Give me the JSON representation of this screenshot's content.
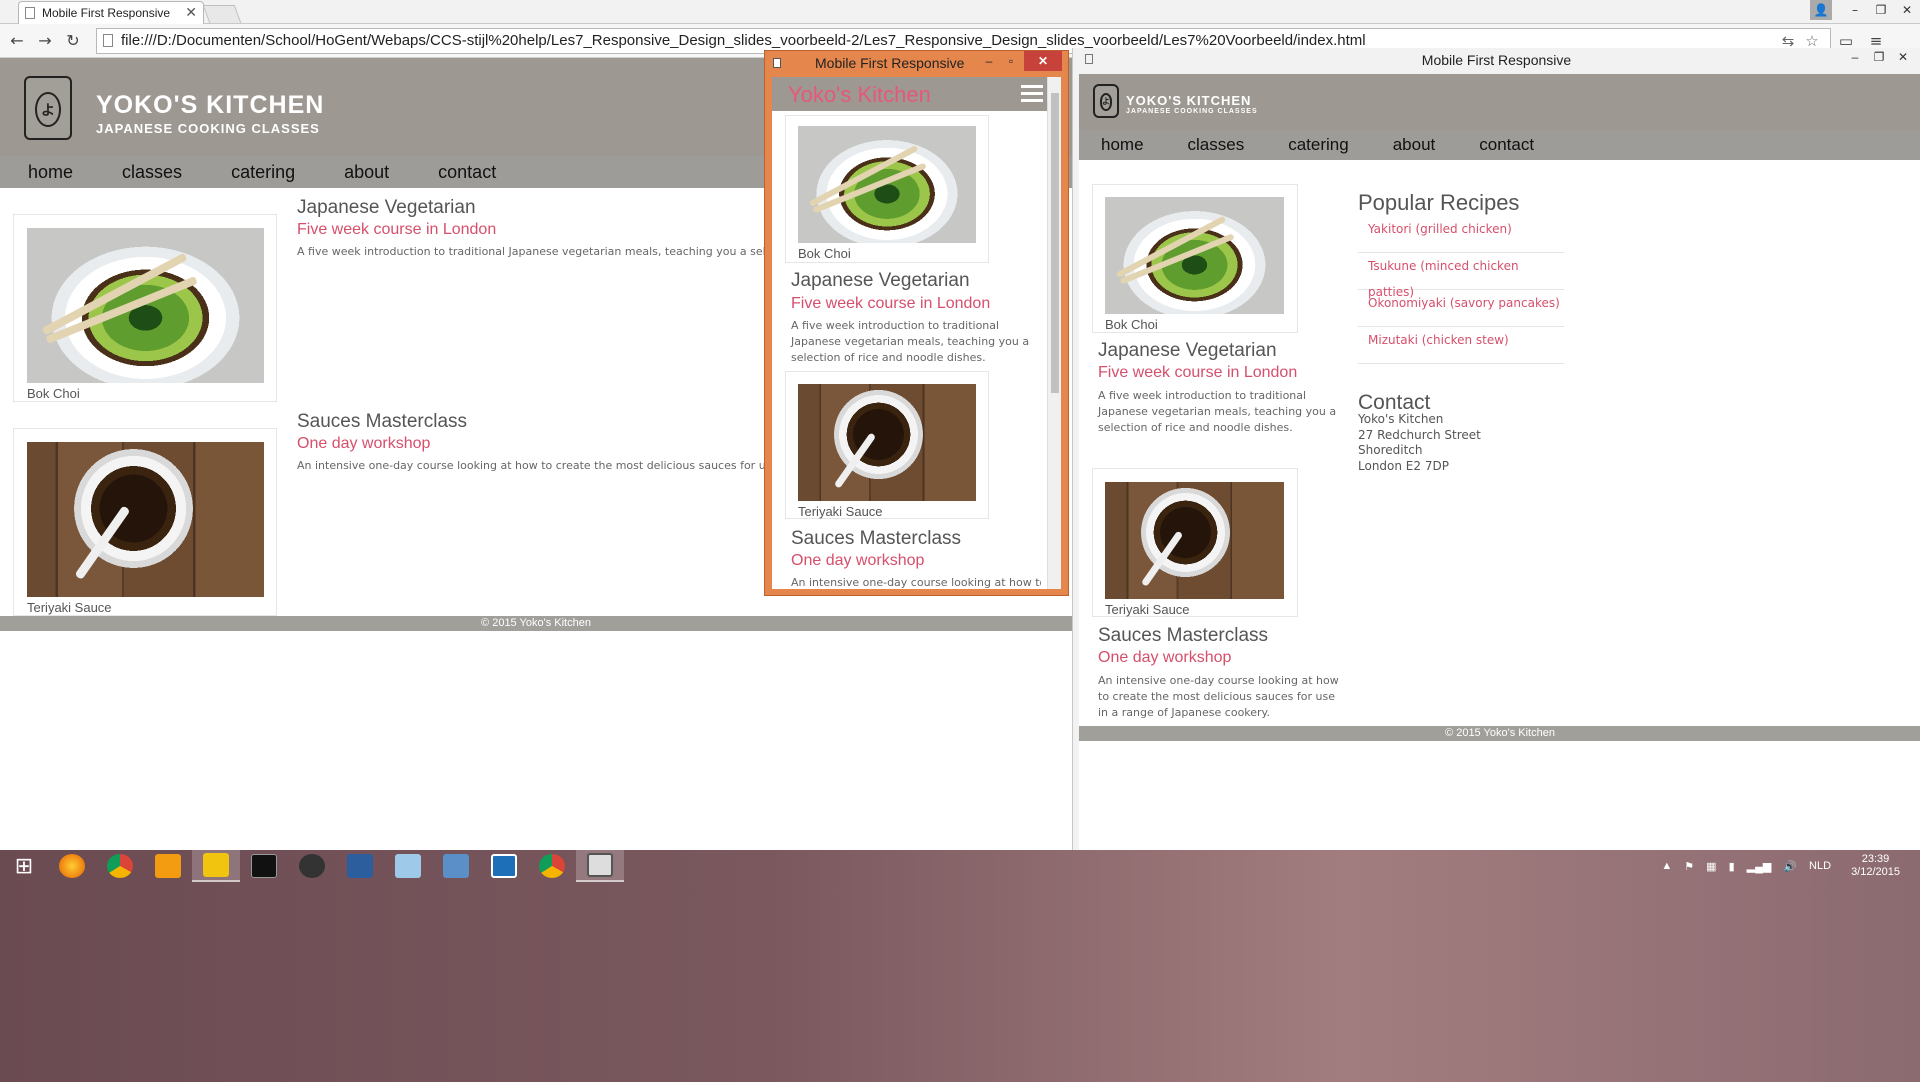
{
  "browser": {
    "tab_title": "Mobile First Responsive",
    "url": "file:///D:/Documenten/School/HoGent/Webaps/CCS-stijl%20help/Les7_Responsive_Design_slides_voorbeeld-2/Les7_Responsive_Design_slides_voorbeeld/Les7%20Voorbeeld/index.html"
  },
  "site": {
    "brand_line1": "YOKO'S KITCHEN",
    "brand_line2": "JAPANESE COOKING CLASSES",
    "nav": [
      "home",
      "classes",
      "catering",
      "about",
      "contact"
    ],
    "footer": "© 2015 Yoko's Kitchen",
    "courses": [
      {
        "caption": "Bok Choi",
        "title": "Japanese Vegetarian",
        "subtitle": "Five week course in London",
        "desc_wide": "A five week introduction to traditional Japanese vegetarian meals, teaching you a sele",
        "desc": "A five week introduction to traditional Japanese vegetarian meals, teaching you a selection of rice and noodle dishes."
      },
      {
        "caption": "Teriyaki Sauce",
        "title": "Sauces Masterclass",
        "subtitle": "One day workshop",
        "desc_wide": "An intensive one-day course looking at how to create the most delicious sauces for us",
        "desc_mobile": "An intensive one-day course looking at how to",
        "desc": "An intensive one-day course looking at how to create the most delicious sauces for use in a range of Japanese cookery."
      }
    ]
  },
  "popup": {
    "window_title": "Mobile First Responsive",
    "mobile_title": "Yoko's Kitchen"
  },
  "desktop": {
    "window_title": "Mobile First Responsive",
    "popular_heading": "Popular Recipes",
    "recipes": [
      "Yakitori (grilled chicken)",
      "Tsukune (minced chicken patties)",
      "Okonomiyaki (savory pancakes)",
      "Mizutaki (chicken stew)"
    ],
    "contact_heading": "Contact",
    "contact_lines": [
      "Yoko's Kitchen",
      "27 Redchurch Street",
      "Shoreditch",
      "London E2 7DP"
    ]
  },
  "taskbar": {
    "apps": [
      "windows-start",
      "firefox",
      "chrome",
      "media-player",
      "file-explorer",
      "command-prompt",
      "obs",
      "notepad",
      "notes",
      "calculator",
      "brackets",
      "chrome",
      "remote-desktop"
    ],
    "language": "NLD",
    "time": "23:39",
    "date": "3/12/2015"
  },
  "colors": {
    "header_gray": "#9d9892",
    "accent_pink": "#d64f6b",
    "popup_frame": "#e5874d",
    "close_red": "#c7423a"
  }
}
